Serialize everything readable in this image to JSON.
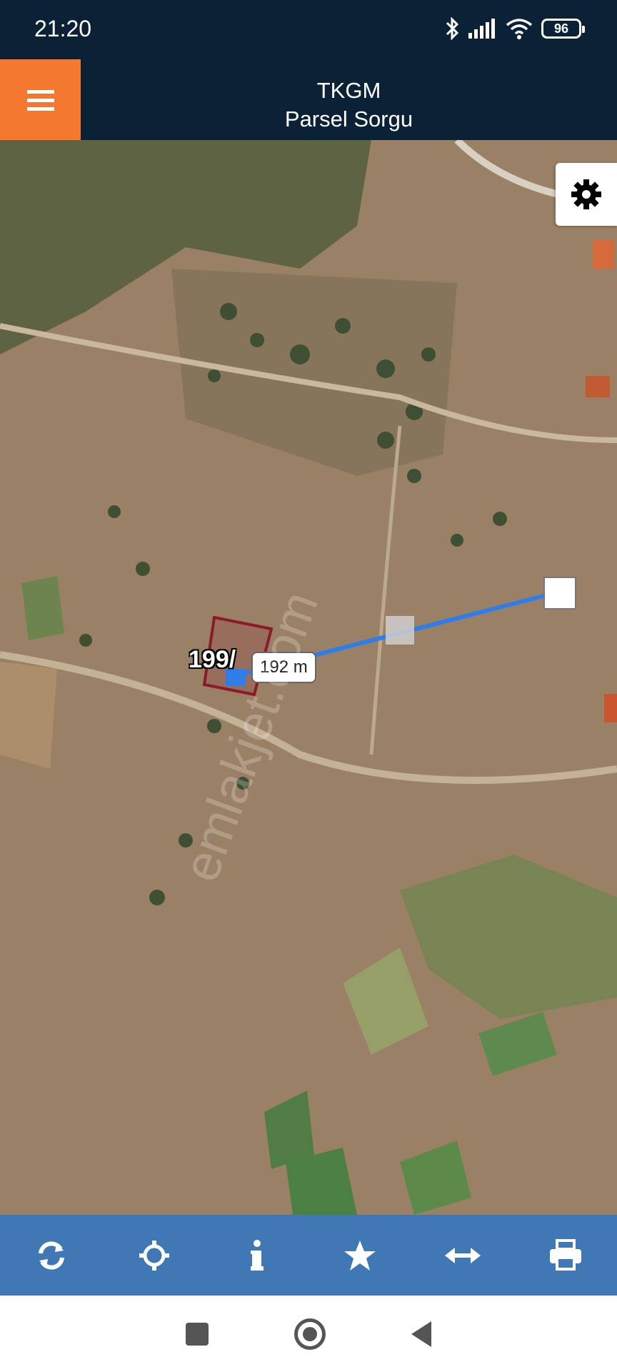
{
  "status": {
    "time": "21:20",
    "battery": "96"
  },
  "header": {
    "title": "TKGM",
    "subtitle": "Parsel Sorgu"
  },
  "map": {
    "parcel_label": "199/",
    "distance": "192 m",
    "watermark": "emlakjet.com",
    "parcel_color": "#8b1a2b",
    "line_color": "#2f7de8"
  },
  "toolbar": {
    "items": [
      "refresh-icon",
      "locate-icon",
      "info-icon",
      "star-icon",
      "measure-icon",
      "print-icon"
    ]
  },
  "colors": {
    "accent": "#f4782f",
    "header": "#0b2236",
    "toolbar": "#3f78b5"
  }
}
